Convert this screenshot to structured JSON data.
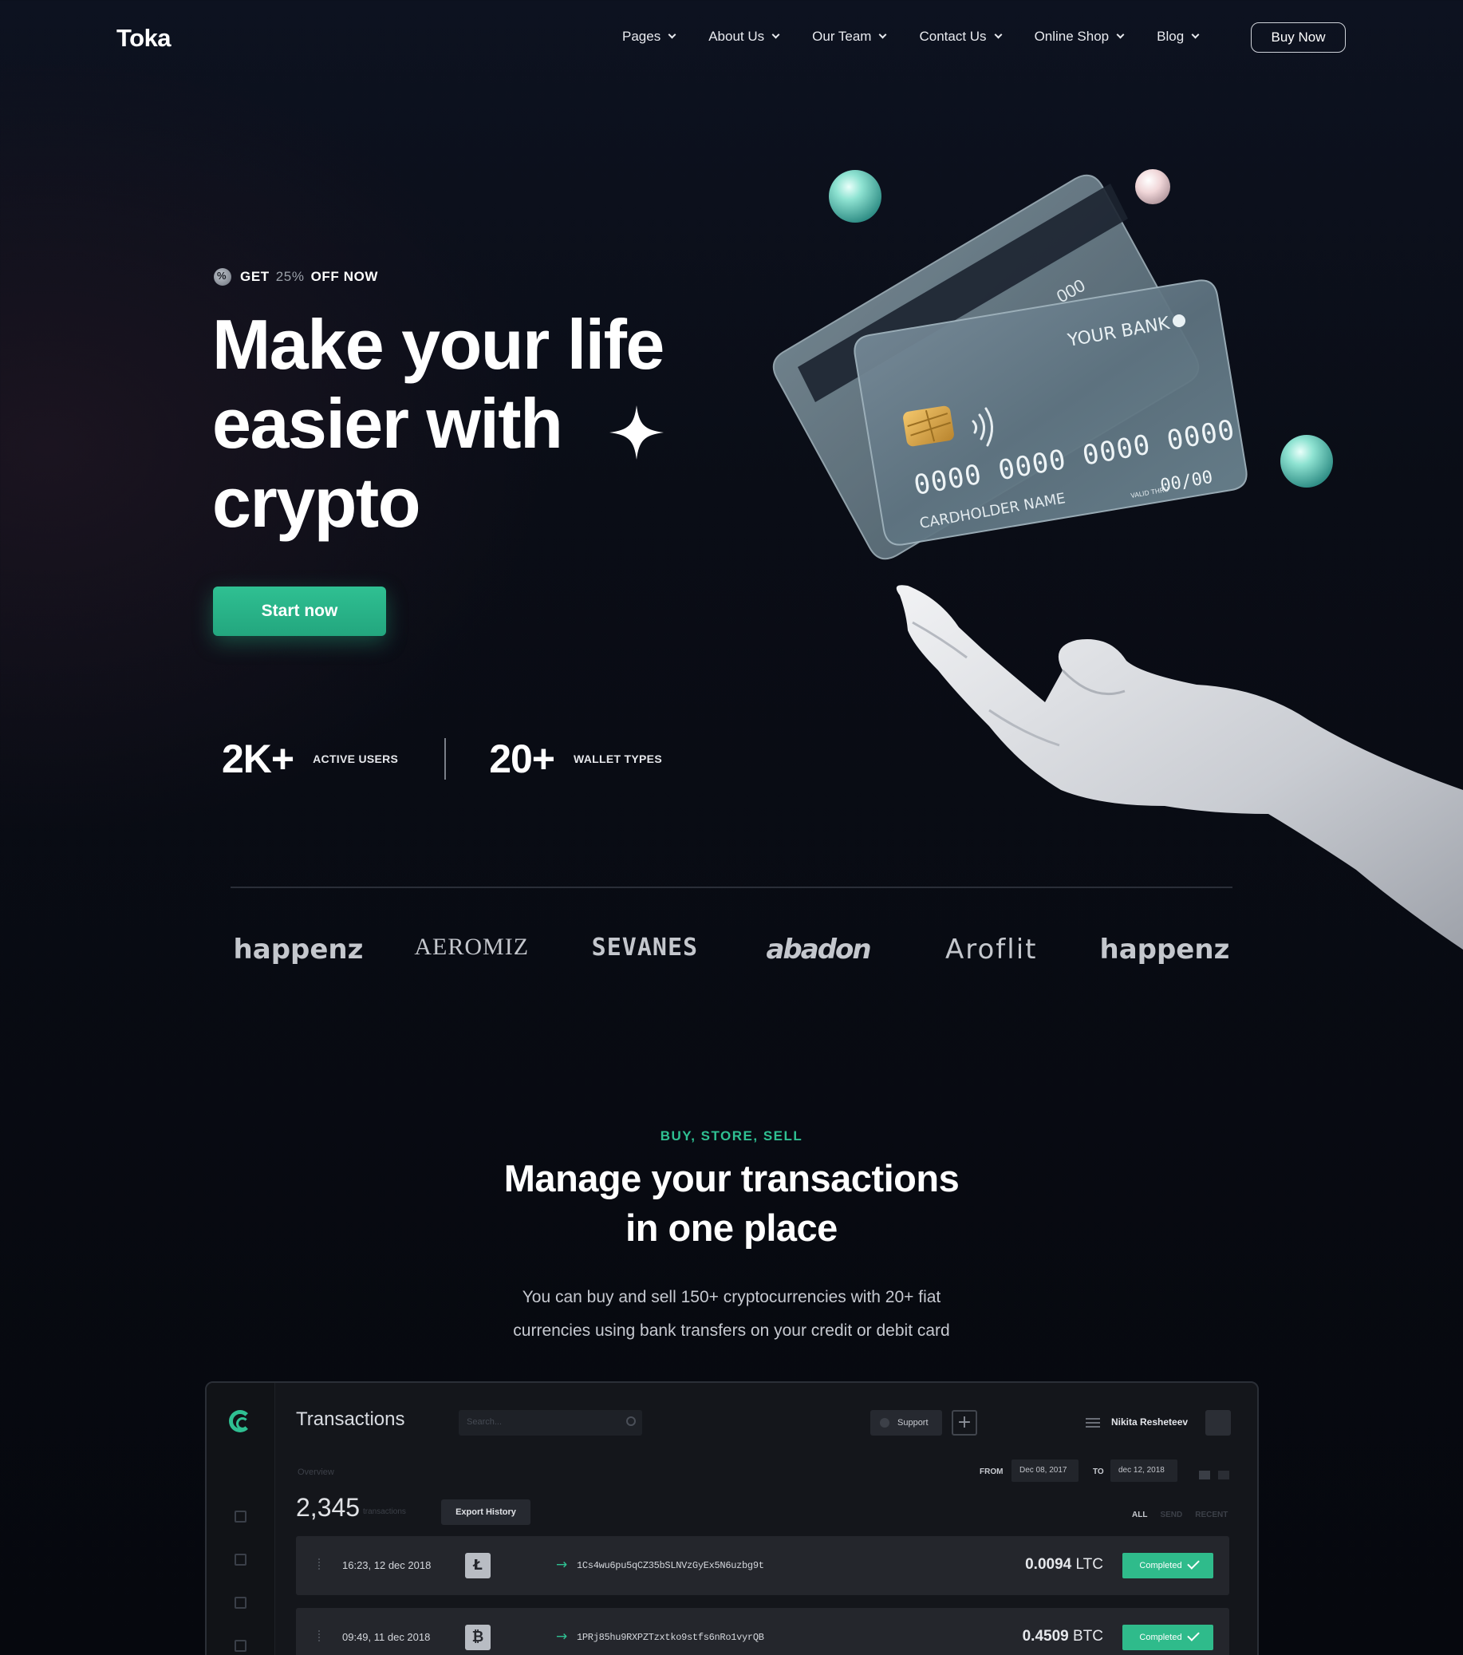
{
  "header": {
    "logo": "Toka",
    "menu": [
      {
        "label": "Pages"
      },
      {
        "label": "About Us"
      },
      {
        "label": "Our Team"
      },
      {
        "label": "Contact Us"
      },
      {
        "label": "Online Shop"
      },
      {
        "label": "Blog"
      }
    ],
    "buy_label": "Buy Now"
  },
  "hero": {
    "promo_get": "GET",
    "promo_pct": "25%",
    "promo_off": "OFF NOW",
    "title_lines": [
      "Make your life",
      "easier with",
      "crypto"
    ],
    "cta": "Start now",
    "stats": [
      {
        "value": "2K+",
        "label": "ACTIVE USERS"
      },
      {
        "value": "20+",
        "label": "WALLET TYPES"
      }
    ],
    "card": {
      "bank": "YOUR BANK",
      "number": "0000  0000  0000  0000",
      "holder": "CARDHOLDER NAME",
      "valid_label": "VALID THRU",
      "expiry": "00/00",
      "back_number": "000"
    }
  },
  "brands": [
    "happenz",
    "AEROMIZ",
    "SEVANES",
    "abadon",
    "Aroflit",
    "happenz"
  ],
  "section": {
    "eyebrow": "BUY, STORE, SELL",
    "title_line1": "Manage your transactions",
    "title_line2": "in one place",
    "desc_line1": "You can buy and sell 150+ cryptocurrencies with 20+ fiat",
    "desc_line2": "currencies using bank transfers on your credit or debit card"
  },
  "dashboard": {
    "title": "Transactions",
    "search_placeholder": "Search...",
    "support_label": "Support",
    "plus_label": "+",
    "user_name": "Nikita Resheteev",
    "overview_label": "Overview",
    "count": "2,345",
    "count_sub": "transactions",
    "export_label": "Export History",
    "from_label": "FROM",
    "from_date": "Dec 08, 2017",
    "to_label": "TO",
    "to_date": "dec 12, 2018",
    "filters": [
      "ALL",
      "SEND",
      "RECENT"
    ],
    "transactions": [
      {
        "time": "16:23, 12 dec 2018",
        "coin_glyph": "Ł",
        "coin_icon": "litecoin-icon",
        "address": "1Cs4wu6pu5qCZ35bSLNVzGyEx5N6uzbg9t",
        "amount": "0.0094",
        "unit": "LTC",
        "status": "Completed"
      },
      {
        "time": "09:49, 11 dec 2018",
        "coin_glyph": "₿",
        "coin_icon": "bitcoin-icon",
        "address": "1PRj85hu9RXPZTzxtko9stfs6nRo1vyrQB",
        "amount": "0.4509",
        "unit": "BTC",
        "status": "Completed"
      }
    ]
  },
  "colors": {
    "accent": "#2fc092",
    "background": "#0a0d16",
    "status_completed": "#2fbb8b"
  },
  "icons": {
    "promo": "percent-badge-icon",
    "sparkle": "sparkle-icon",
    "chevron": "chevron-down-icon",
    "contactless": "contactless-icon",
    "chip": "card-chip-icon"
  }
}
